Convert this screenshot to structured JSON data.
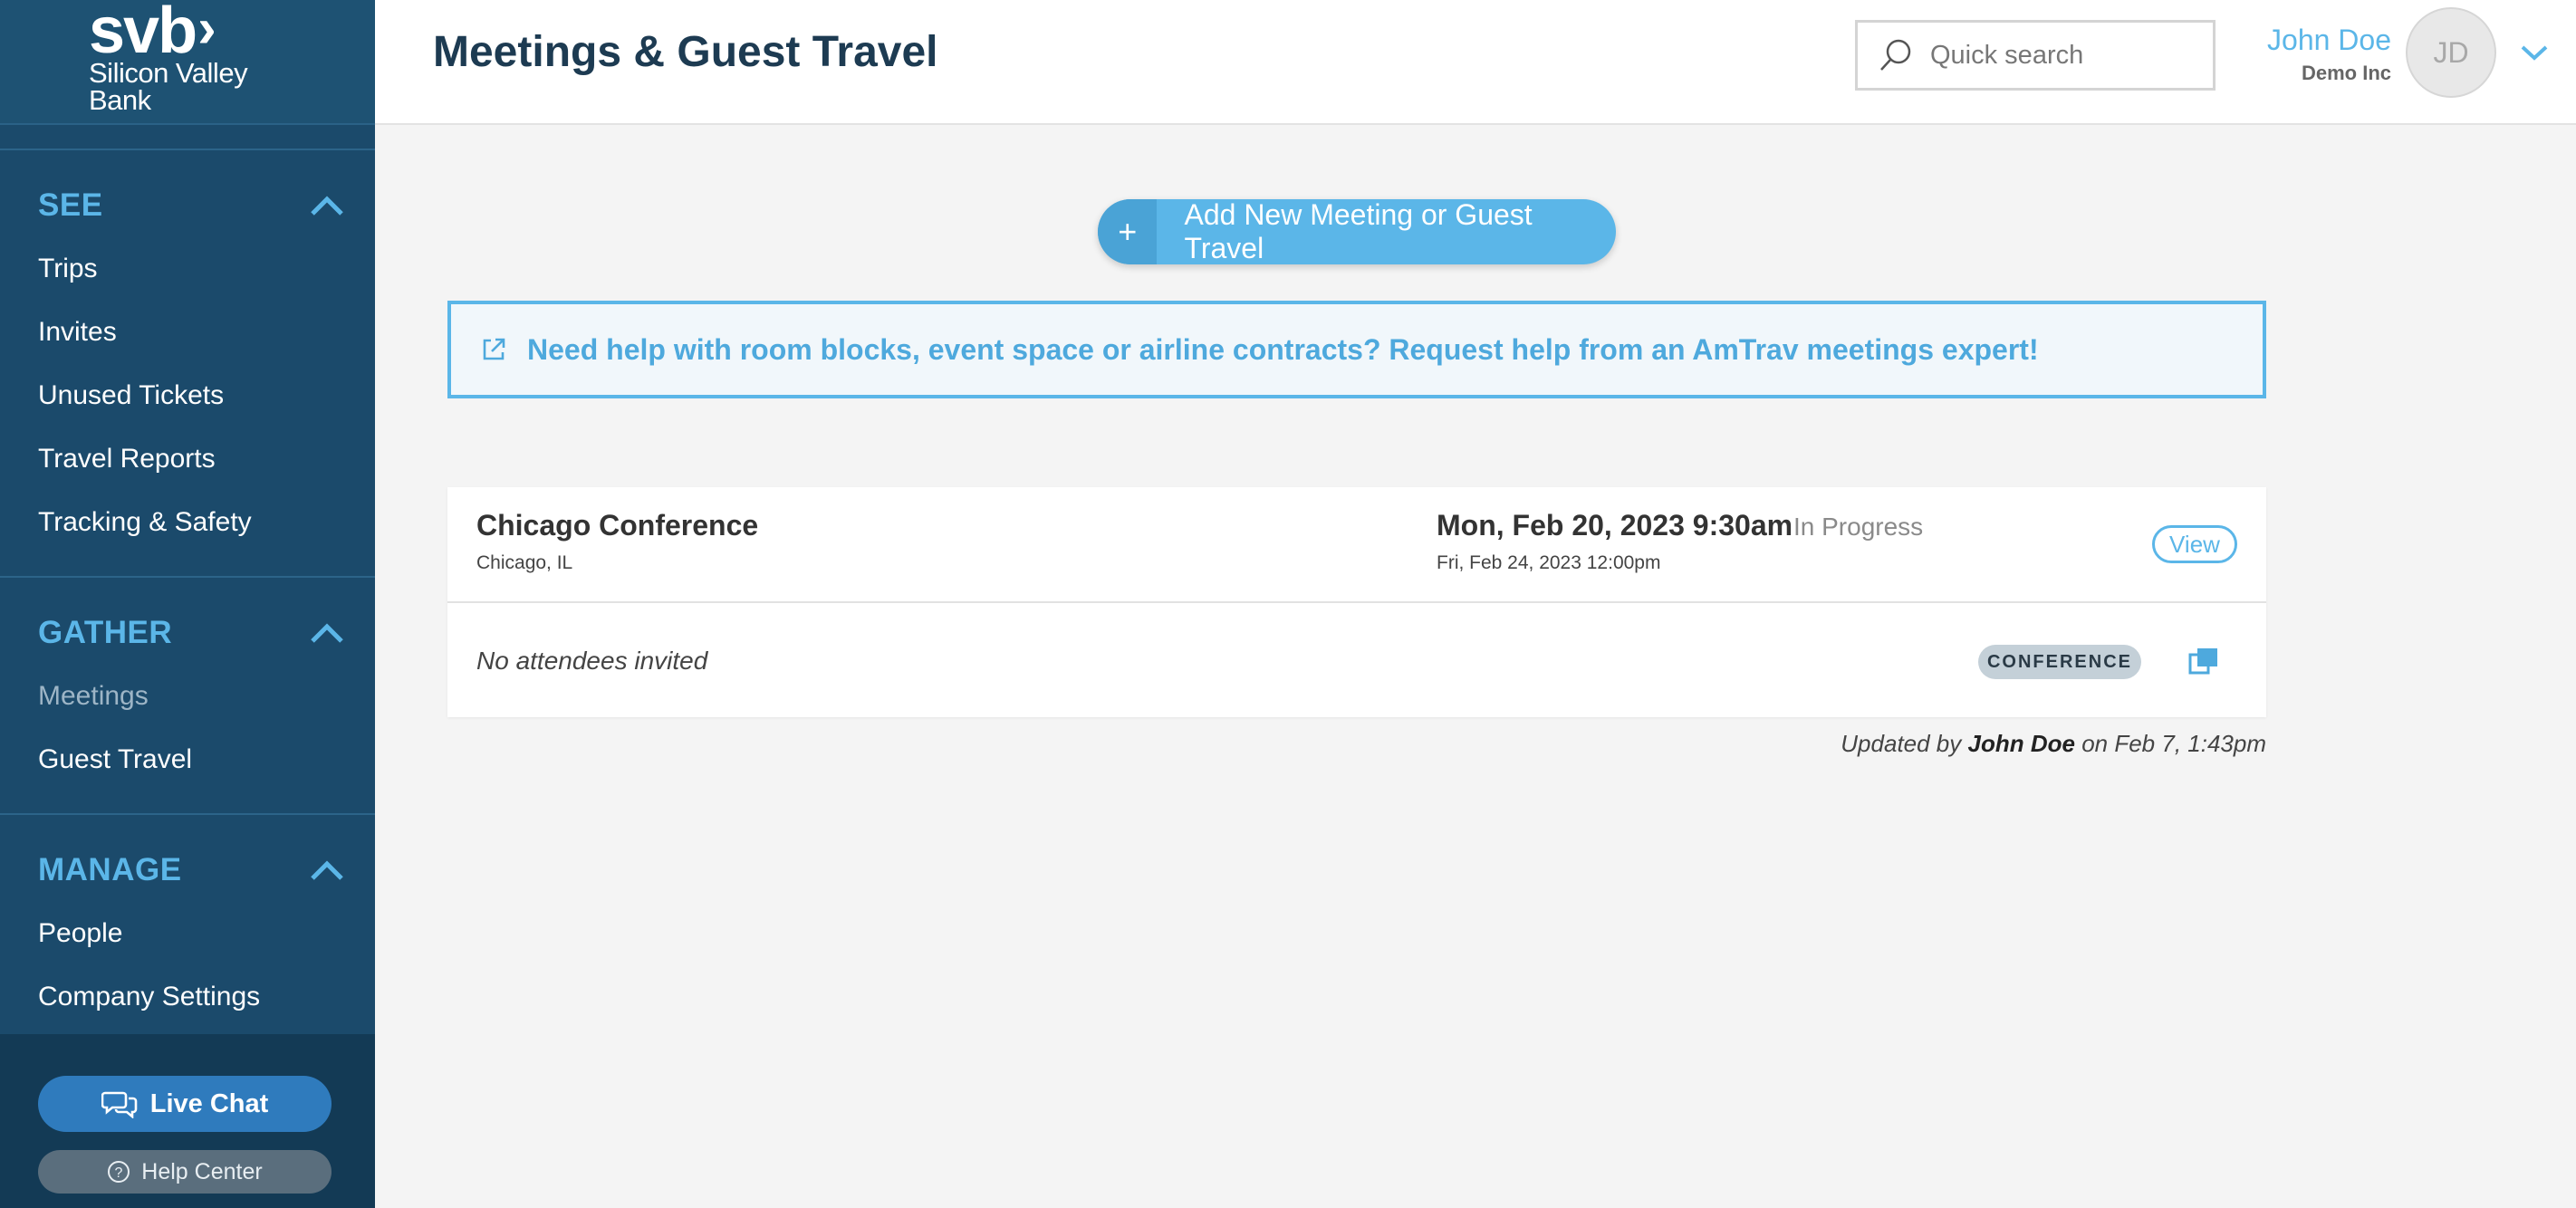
{
  "brand": {
    "logo_mark": "svb",
    "logo_line1": "Silicon Valley",
    "logo_line2": "Bank"
  },
  "sidebar": {
    "sections": [
      {
        "label": "SEE",
        "items": [
          "Trips",
          "Invites",
          "Unused Tickets",
          "Travel Reports",
          "Tracking & Safety"
        ]
      },
      {
        "label": "GATHER",
        "items": [
          "Meetings",
          "Guest Travel"
        ],
        "active": "Meetings"
      },
      {
        "label": "MANAGE",
        "items": [
          "People",
          "Company Settings"
        ]
      }
    ],
    "live_chat_label": "Live Chat",
    "help_center_label": "Help Center"
  },
  "header": {
    "title": "Meetings & Guest Travel",
    "search_placeholder": "Quick search",
    "user_name": "John Doe",
    "user_company": "Demo Inc",
    "avatar_initials": "JD"
  },
  "main": {
    "add_button_plus": "+",
    "add_button_label": "Add New Meeting or Guest Travel",
    "help_banner_text": "Need help with room blocks, event space or airline contracts? Request help from an AmTrav meetings expert!",
    "meeting": {
      "name": "Chicago Conference",
      "location": "Chicago, IL",
      "start": "Mon, Feb 20, 2023 9:30am",
      "end": "Fri, Feb 24, 2023 12:00pm",
      "status": "In Progress",
      "view_label": "View",
      "attendees_text": "No attendees invited",
      "type_badge": "CONFERENCE"
    },
    "updated": {
      "prefix": "Updated by",
      "user": "John Doe",
      "suffix": "on Feb 7, 1:43pm"
    }
  },
  "colors": {
    "sidebar_bg": "#1b4a6b",
    "accent": "#5bb6e8",
    "title": "#1d3b52"
  }
}
